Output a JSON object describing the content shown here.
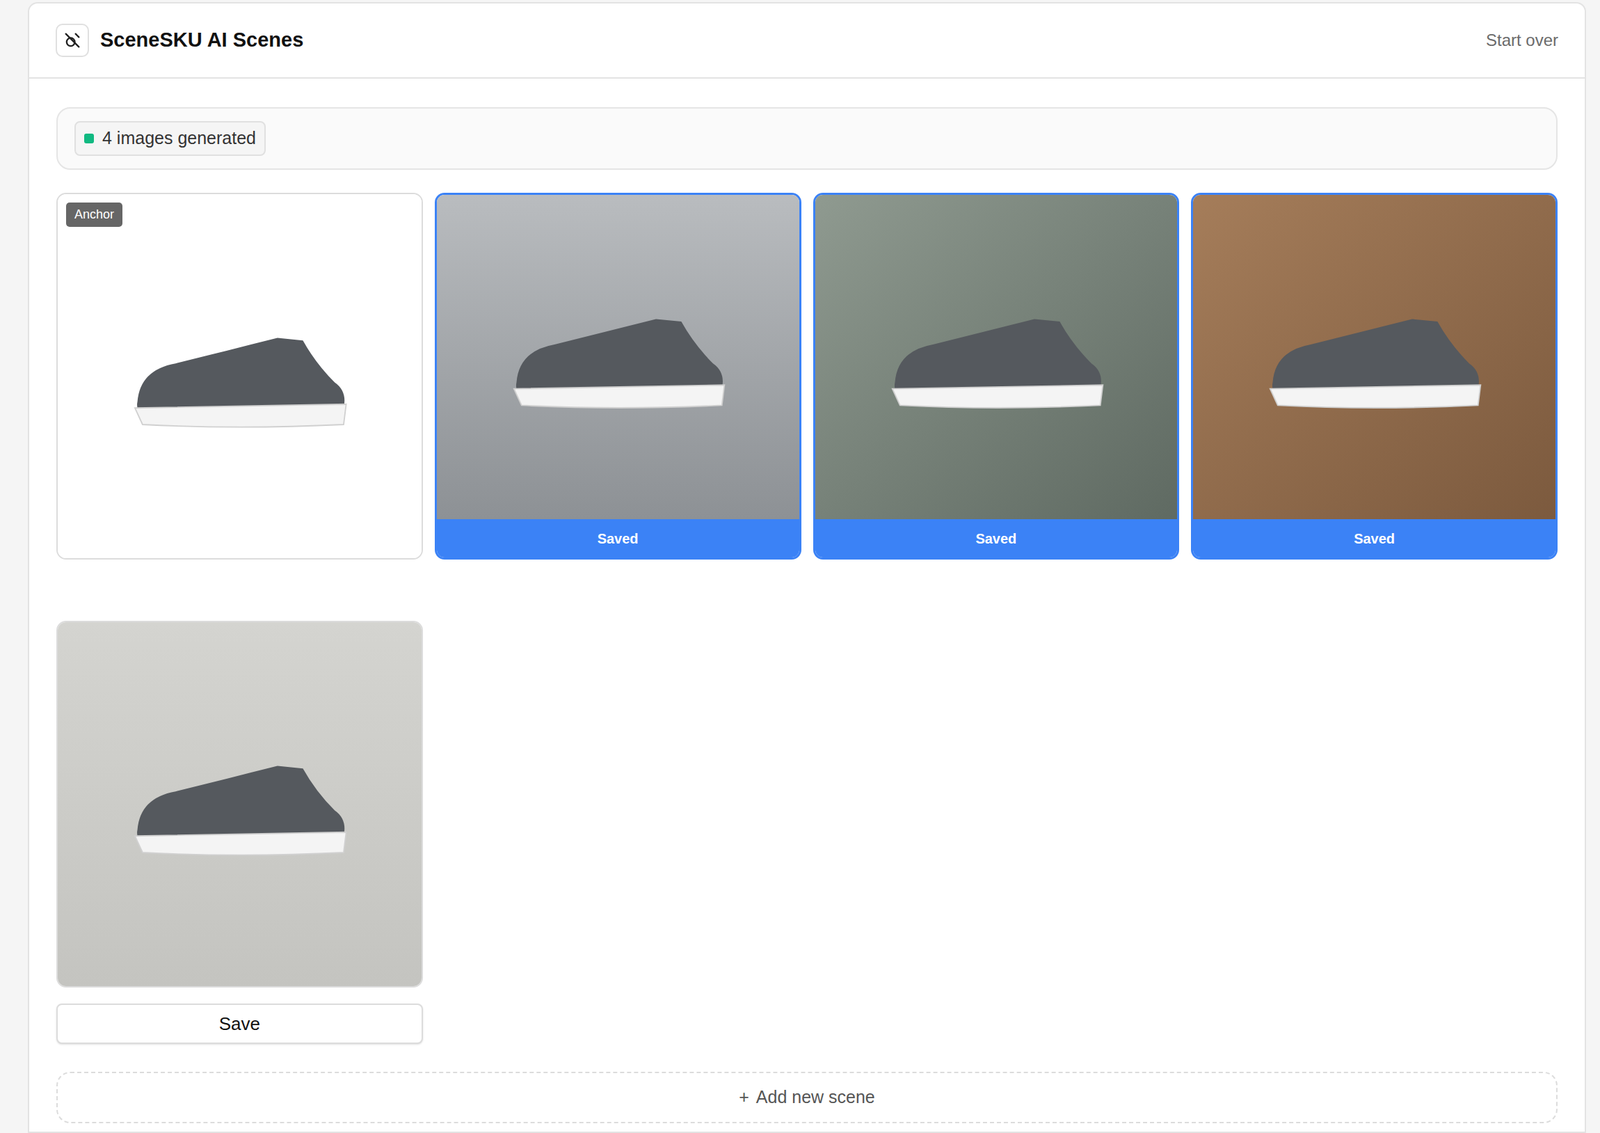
{
  "header": {
    "title": "SceneSKU AI Scenes",
    "action": "Start over"
  },
  "status": {
    "text": "4 images generated"
  },
  "scenes": [
    {
      "kind": "anchor",
      "badge": "Anchor",
      "saved": false
    },
    {
      "kind": "generated",
      "saved": true,
      "label": "Saved"
    },
    {
      "kind": "generated",
      "saved": true,
      "label": "Saved"
    },
    {
      "kind": "generated",
      "saved": true,
      "label": "Saved"
    },
    {
      "kind": "generated",
      "saved": false,
      "label": "Save"
    }
  ],
  "add_button": {
    "icon": "+",
    "label": "Add new scene"
  }
}
